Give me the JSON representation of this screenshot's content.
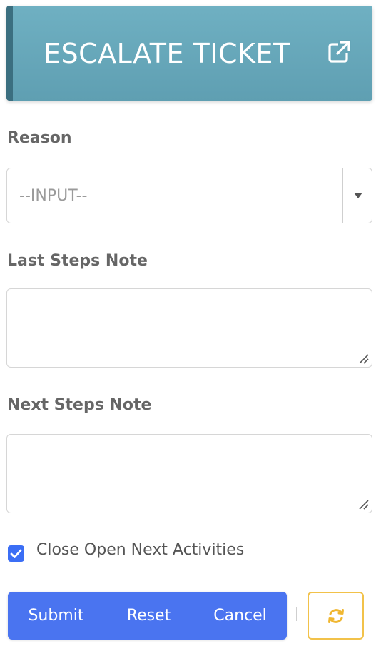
{
  "header": {
    "title": "ESCALATE TICKET",
    "icon": "external-link-icon"
  },
  "form": {
    "reason": {
      "label": "Reason",
      "value": "--INPUT--",
      "icon": "caret-down-icon"
    },
    "last_steps_note": {
      "label": "Last Steps Note",
      "value": ""
    },
    "next_steps_note": {
      "label": "Next Steps Note",
      "value": ""
    },
    "close_open_next_activities": {
      "label": "Close Open Next Activities",
      "checked": true
    }
  },
  "actions": {
    "submit_label": "Submit",
    "reset_label": "Reset",
    "cancel_label": "Cancel",
    "refresh_icon": "refresh-icon"
  },
  "colors": {
    "header_bg": "#65a6b8",
    "header_accent": "#3b6f80",
    "primary": "#4a74f0",
    "refresh_border": "#f2c24a",
    "refresh_icon": "#f0b731"
  }
}
